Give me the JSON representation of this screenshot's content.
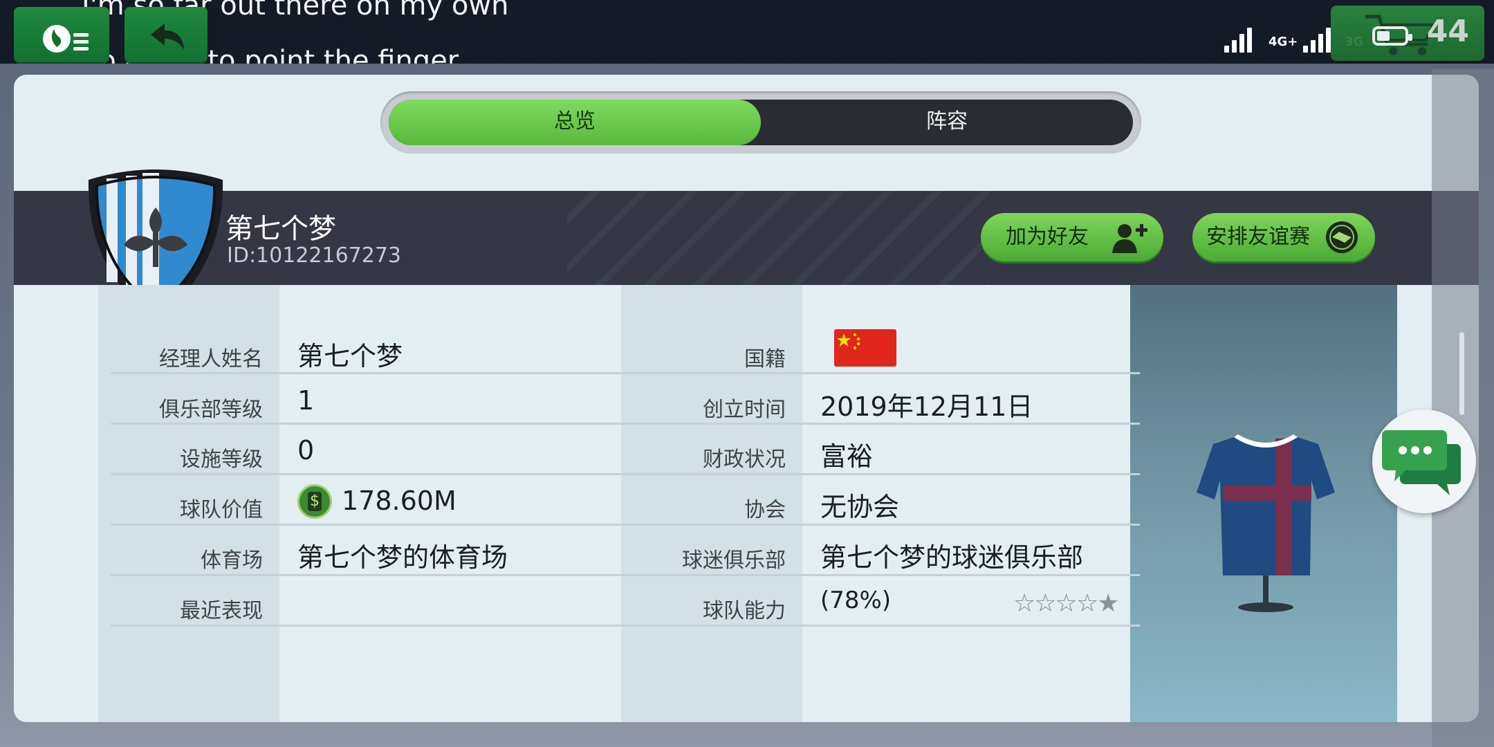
{
  "status_bar": {
    "lyric_line1": "I'm so far out there on my own",
    "lyric_line2": "So quick to point the finger",
    "net1": "4G+",
    "net2": "3G",
    "cart_count": "44",
    "icons": [
      "menu-icon",
      "back-icon",
      "cart-icon",
      "signal-icon",
      "battery-icon"
    ]
  },
  "tabs": {
    "overview": "总览",
    "squad": "阵容",
    "active": "overview"
  },
  "club": {
    "name": "第七个梦",
    "id": "ID:10122167273"
  },
  "buttons": {
    "add_friend": "加为好友",
    "arrange_friendly": "安排友谊赛"
  },
  "info_left": [
    {
      "label": "经理人姓名",
      "value": "第七个梦"
    },
    {
      "label": "俱乐部等级",
      "value": "1"
    },
    {
      "label": "设施等级",
      "value": "0"
    },
    {
      "label": "球队价值",
      "value": "178.60M"
    },
    {
      "label": "体育场",
      "value": "第七个梦的体育场"
    },
    {
      "label": "最近表现",
      "value": ""
    }
  ],
  "info_right": [
    {
      "label": "国籍",
      "value": ""
    },
    {
      "label": "创立时间",
      "value": "2019年12月11日"
    },
    {
      "label": "财政状况",
      "value": "富裕"
    },
    {
      "label": "协会",
      "value": "无协会"
    },
    {
      "label": "球迷俱乐部",
      "value": "第七个梦的球迷俱乐部"
    },
    {
      "label": "球队能力",
      "value": "(78%)"
    }
  ],
  "team_rating": {
    "stars_filled": 1,
    "stars_total": 5,
    "percent": 78
  },
  "colors": {
    "accent_green": "#5bb83d",
    "banner": "#353745",
    "panel": "#e2eef2",
    "flag_red": "#e1261c"
  }
}
